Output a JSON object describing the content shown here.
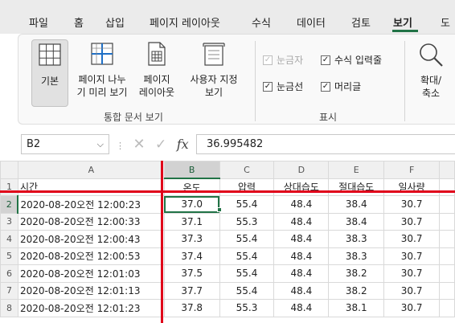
{
  "menu": {
    "tabs": [
      "파일",
      "홈",
      "삽입",
      "페이지 레이아웃",
      "수식",
      "데이터",
      "검토",
      "보기",
      "도"
    ],
    "active_tab": "보기"
  },
  "ribbon": {
    "workbook_views": {
      "normal": "기본",
      "page_break_1": "페이지 나누",
      "page_break_2": "기 미리 보기",
      "page_layout_1": "페이지",
      "page_layout_2": "레이아웃",
      "custom_1": "사용자 지정",
      "custom_2": "보기",
      "group_label": "통합 문서 보기"
    },
    "show": {
      "ruler": "눈금자",
      "formula_bar": "수식 입력줄",
      "gridlines": "눈금선",
      "headings": "머리글",
      "group_label": "표시"
    },
    "zoom": {
      "label_1": "확대/",
      "label_2": "축소"
    }
  },
  "formula_bar": {
    "name_box": "B2",
    "formula": "36.995482",
    "fx": "fx"
  },
  "sheet": {
    "columns": [
      "A",
      "B",
      "C",
      "D",
      "E",
      "F"
    ],
    "selected_column": "B",
    "selected_row": "2",
    "row_numbers": [
      "1",
      "2",
      "3",
      "4",
      "5",
      "6",
      "7",
      "8"
    ],
    "headers": [
      "시간",
      "온도",
      "압력",
      "상대습도",
      "절대습도",
      "일사량"
    ],
    "rows": [
      [
        "2020-08-20오전 12:00:23",
        "37.0",
        "55.4",
        "48.4",
        "38.4",
        "30.7"
      ],
      [
        "2020-08-20오전 12:00:33",
        "37.1",
        "55.3",
        "48.4",
        "38.4",
        "30.7"
      ],
      [
        "2020-08-20오전 12:00:43",
        "37.3",
        "55.4",
        "48.4",
        "38.3",
        "30.7"
      ],
      [
        "2020-08-20오전 12:00:53",
        "37.4",
        "55.4",
        "48.4",
        "38.3",
        "30.7"
      ],
      [
        "2020-08-20오전 12:01:03",
        "37.5",
        "55.4",
        "48.4",
        "38.2",
        "30.7"
      ],
      [
        "2020-08-20오전 12:01:13",
        "37.7",
        "55.4",
        "48.4",
        "38.2",
        "30.7"
      ],
      [
        "2020-08-20오전 12:01:23",
        "37.8",
        "55.3",
        "48.4",
        "38.1",
        "30.7"
      ]
    ]
  },
  "colors": {
    "accent": "#217346",
    "annotation": "#e0001a"
  }
}
